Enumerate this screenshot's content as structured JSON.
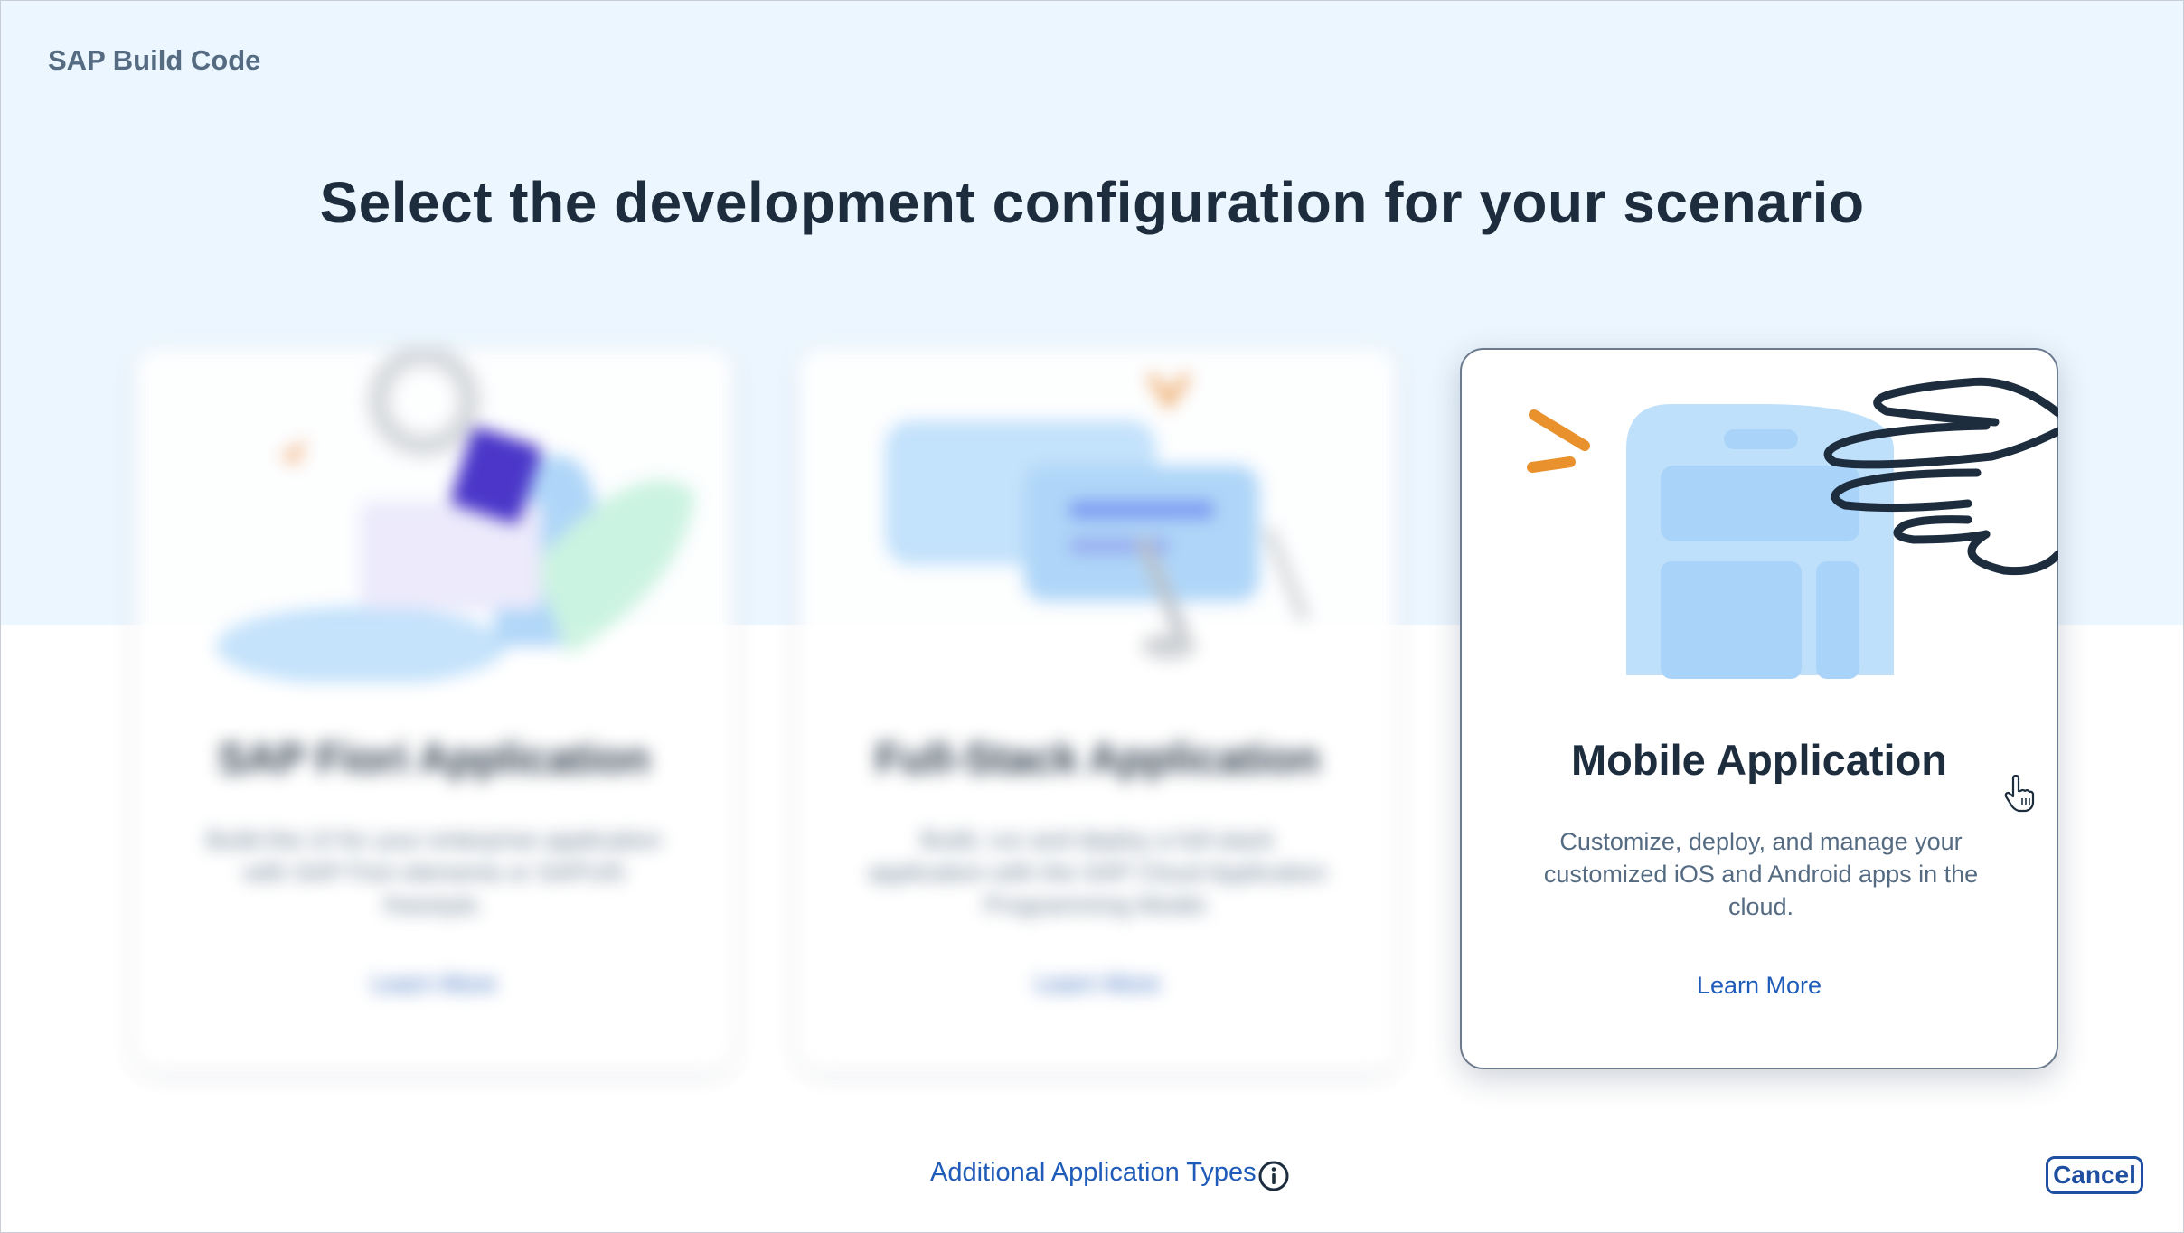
{
  "app": {
    "title": "SAP Build Code"
  },
  "main": {
    "heading": "Select the development configuration for your scenario"
  },
  "cards": [
    {
      "title": "SAP Fiori Application",
      "description": "Build the UI for your enterprise application with SAP Fiori elements or SAPUI5 freestyle.",
      "link": "Learn More",
      "state": "blurred",
      "icon": "fiori-illustration"
    },
    {
      "title": "Full-Stack Application",
      "description": "Build, run and deploy a full-stack application with the SAP Cloud Application Programming Model.",
      "link": "Learn More",
      "state": "blurred",
      "icon": "full-stack-illustration"
    },
    {
      "title": "Mobile Application",
      "description": "Customize, deploy, and manage your customized iOS and Android apps in the cloud.",
      "link": "Learn More",
      "state": "hovered",
      "icon": "mobile-phone-hand-illustration"
    }
  ],
  "footer": {
    "additional_link": "Additional Application Types",
    "info_icon": "info-icon",
    "cancel_label": "Cancel"
  },
  "colors": {
    "hero_background": "#ecf6fe",
    "heading": "#1d2d3e",
    "link": "#1f5bb8",
    "accent_orange": "#e8912d",
    "phone_blue": "#bfe0fb"
  }
}
